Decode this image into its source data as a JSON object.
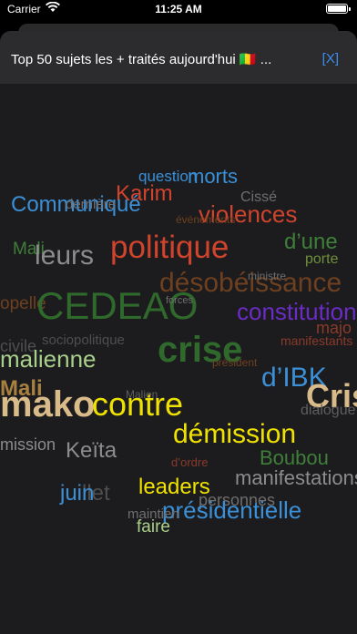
{
  "status_bar": {
    "carrier": "Carrier",
    "time": "11:25 AM"
  },
  "header": {
    "title": "Top 50 sujets les + traités aujourd'hui 🇲🇱 ...",
    "close_label": "[X]"
  },
  "words": [
    {
      "text": "question",
      "color": "#3b8fd6"
    },
    {
      "text": "morts",
      "color": "#3b8fd6"
    },
    {
      "text": "Karim",
      "color": "#d0432c"
    },
    {
      "text": "Cissé",
      "color": "#6e6e6e"
    },
    {
      "text": "Communiqué",
      "color": "#3b8fd6"
    },
    {
      "text": "dernière",
      "color": "#6e6e6e"
    },
    {
      "text": "violences",
      "color": "#d0432c"
    },
    {
      "text": "événements",
      "color": "#6e4020"
    },
    {
      "text": "Mali",
      "color": "#3f7f3a"
    },
    {
      "text": "leurs",
      "color": "#8c8c8c"
    },
    {
      "text": "politique",
      "color": "#d0432c"
    },
    {
      "text": "d’une",
      "color": "#3f7f3a"
    },
    {
      "text": "porte",
      "color": "#6f8f3a"
    },
    {
      "text": "désobéissance",
      "color": "#6e4020"
    },
    {
      "text": "ministre",
      "color": "#6e6e6e"
    },
    {
      "text": "opelle",
      "color": "#6e4020"
    },
    {
      "text": "CEDEAO",
      "color": "#2f6a2c"
    },
    {
      "text": "forces",
      "color": "#6e6e6e"
    },
    {
      "text": "constitution",
      "color": "#6a2cc4"
    },
    {
      "text": "majo",
      "color": "#8a3a2a"
    },
    {
      "text": "sociopolitique",
      "color": "#4e4e4e"
    },
    {
      "text": "civile",
      "color": "#4e4e4e"
    },
    {
      "text": "crise",
      "color": "#2f6a2c"
    },
    {
      "text": "manifestants",
      "color": "#8a3a2a"
    },
    {
      "text": "malienne",
      "color": "#a8d08a"
    },
    {
      "text": "président",
      "color": "#6e4020"
    },
    {
      "text": "d’IBK",
      "color": "#3b8fd6"
    },
    {
      "text": "Mali",
      "color": "#a88040"
    },
    {
      "text": "mako",
      "color": "#d9bb8a"
    },
    {
      "text": "contre",
      "color": "#f0e200"
    },
    {
      "text": "Malien",
      "color": "#5e5e5e"
    },
    {
      "text": "Cris",
      "color": "#d9bb8a"
    },
    {
      "text": "dialogue",
      "color": "#5e5e5e"
    },
    {
      "text": "démission",
      "color": "#f0e200"
    },
    {
      "text": "mission",
      "color": "#8c8c8c"
    },
    {
      "text": "Keïta",
      "color": "#8c8c8c"
    },
    {
      "text": "d’ordre",
      "color": "#8a3a2a"
    },
    {
      "text": "Boubou",
      "color": "#3f7f3a"
    },
    {
      "text": "leaders",
      "color": "#f0e200"
    },
    {
      "text": "manifestations",
      "color": "#8c8c8c"
    },
    {
      "text": "juillet",
      "color": "#4e4e4e"
    },
    {
      "text": "juin",
      "color": "#3b8fd6"
    },
    {
      "text": "personnes",
      "color": "#6e6e6e"
    },
    {
      "text": "présidentielle",
      "color": "#3b8fd6"
    },
    {
      "text": "maintien",
      "color": "#6e6e6e"
    },
    {
      "text": "faire",
      "color": "#a8d08a"
    }
  ]
}
